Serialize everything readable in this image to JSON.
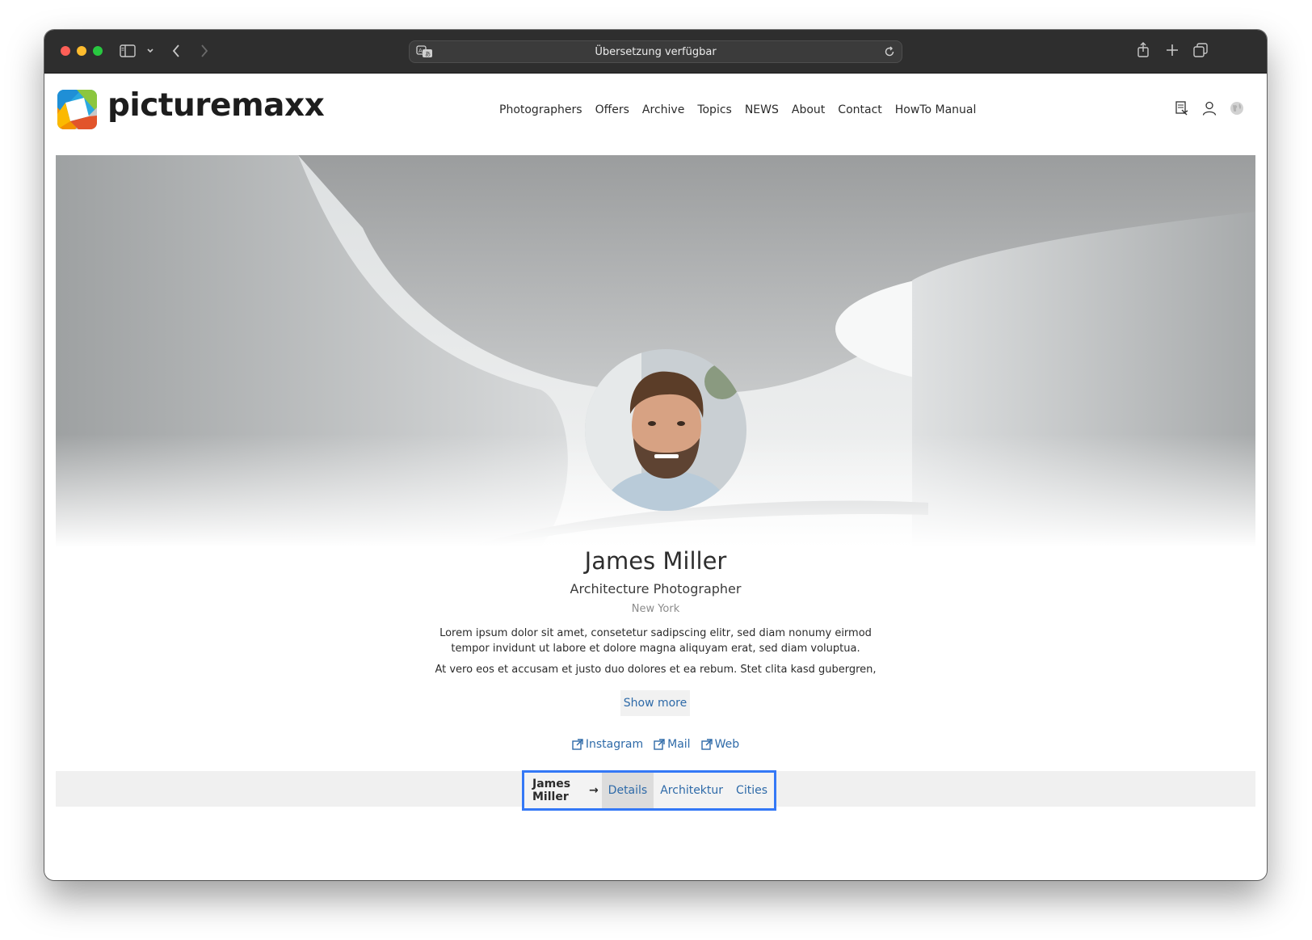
{
  "browser": {
    "address_text": "Übersetzung verfügbar"
  },
  "site": {
    "logo_text": "picturemaxx",
    "nav": [
      "Photographers",
      "Offers",
      "Archive",
      "Topics",
      "NEWS",
      "About",
      "Contact",
      "HowTo Manual"
    ]
  },
  "profile": {
    "name": "James Miller",
    "role": "Architecture Photographer",
    "city": "New York",
    "para1_line1": "Lorem ipsum dolor sit amet, consetetur sadipscing elitr, sed diam nonumy eirmod",
    "para1_line2": "tempor invidunt ut labore et dolore magna aliquyam erat, sed diam voluptua.",
    "para2": "At vero eos et accusam et justo duo dolores et ea rebum. Stet clita kasd gubergren,",
    "show_more": "Show more",
    "links": {
      "instagram": "Instagram",
      "mail": "Mail",
      "web": "Web"
    }
  },
  "subnav": {
    "crumb": "James Miller",
    "arrow": "→",
    "tabs": [
      "Details",
      "Architektur",
      "Cities"
    ]
  },
  "colors": {
    "accent": "#2e6aa8",
    "highlight": "#3478f6"
  }
}
